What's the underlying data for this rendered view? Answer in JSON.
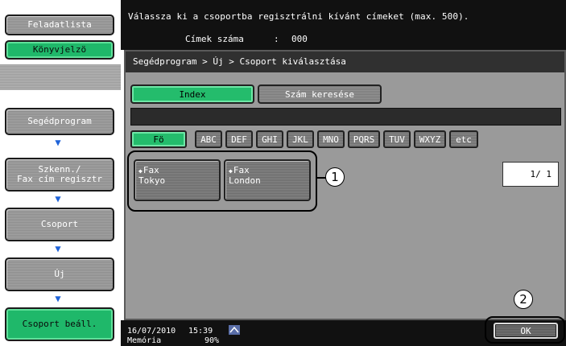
{
  "sidebar": {
    "task_list_label": "Feladatlista",
    "bookmark_label": "Könyvjelzö",
    "steps": [
      {
        "label": "Segédprogram"
      },
      {
        "label": "Szkenn./\nFax cím regisztr"
      },
      {
        "label": "Csoport"
      },
      {
        "label": "Új"
      },
      {
        "label": "Csoport beáll."
      }
    ]
  },
  "header": {
    "message": "Válassza ki a csoportba regisztrálni kívánt címeket (max. 500).",
    "count_label": "Címek száma",
    "count_separator": ":",
    "count_value": "000"
  },
  "breadcrumb": "Segédprogram > Új > Csoport kiválasztása",
  "tabs": [
    {
      "label": "Index",
      "active": true
    },
    {
      "label": "Szám keresése",
      "active": false
    }
  ],
  "index_keys": [
    {
      "label": "Fö",
      "active": true
    },
    {
      "label": "ABC",
      "active": false
    },
    {
      "label": "DEF",
      "active": false
    },
    {
      "label": "GHI",
      "active": false
    },
    {
      "label": "JKL",
      "active": false
    },
    {
      "label": "MNO",
      "active": false
    },
    {
      "label": "PQRS",
      "active": false
    },
    {
      "label": "TUV",
      "active": false
    },
    {
      "label": "WXYZ",
      "active": false
    },
    {
      "label": "etc",
      "active": false
    }
  ],
  "destinations": [
    {
      "type": "Fax",
      "name": "Tokyo"
    },
    {
      "type": "Fax",
      "name": "London"
    }
  ],
  "page_indicator": "1/ 1",
  "callouts": [
    "1",
    "2"
  ],
  "status": {
    "date": "16/07/2010",
    "time": "15:39",
    "memory_label": "Memória",
    "memory_value": "90%"
  },
  "ok_label": "OK",
  "colors": {
    "accent_green": "#24bc6c",
    "arrow_blue": "#1f63d8",
    "bar_dark": "#111111"
  }
}
